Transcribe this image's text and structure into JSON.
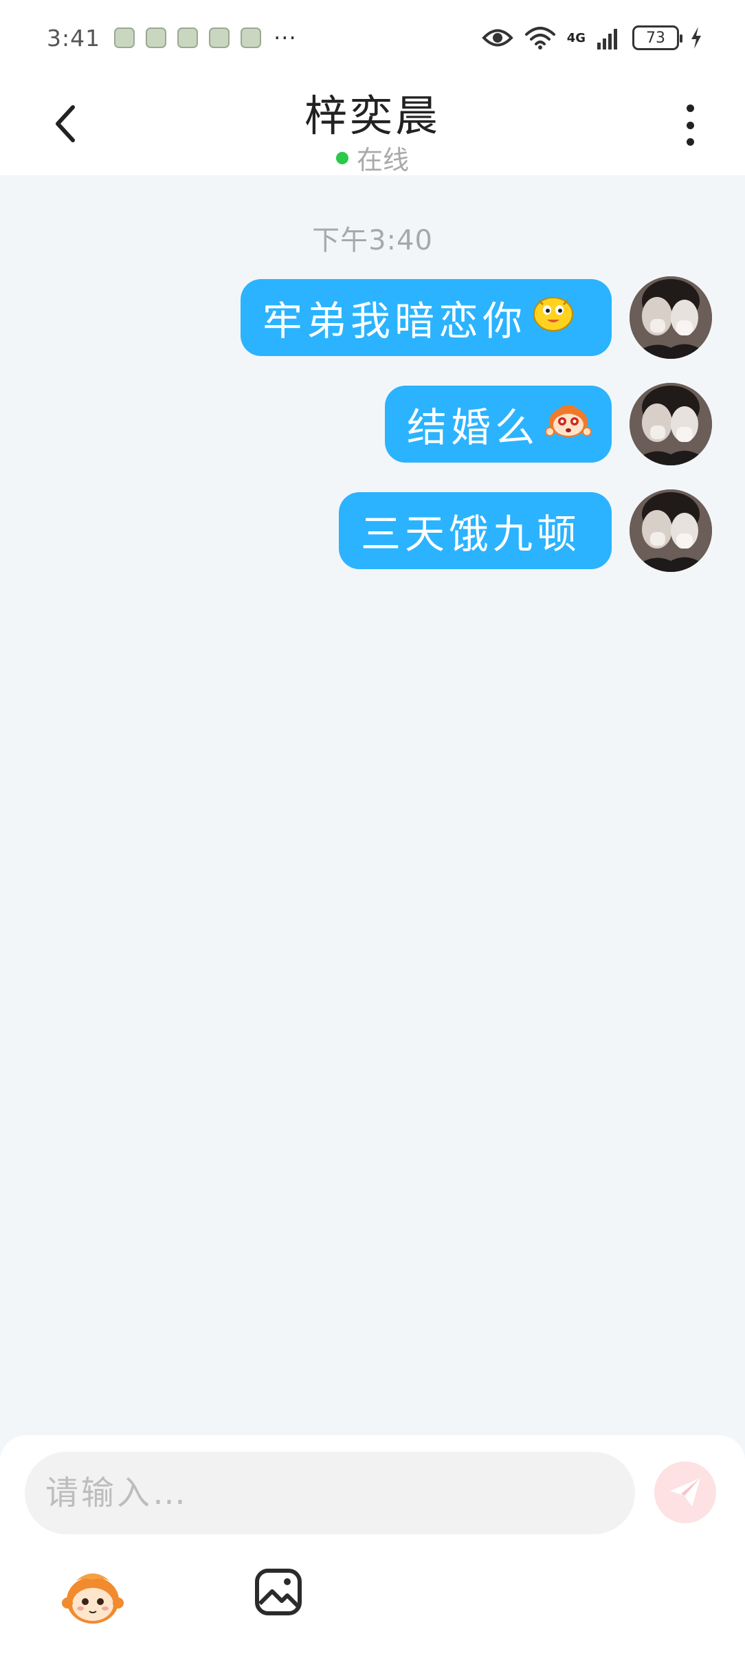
{
  "status_bar": {
    "time": "3:41",
    "app_icons": [
      "app-notification-icon",
      "app-notification-icon",
      "app-notification-icon",
      "app-notification-icon",
      "app-notification-icon"
    ],
    "more": "···",
    "network": "4G",
    "battery": "73"
  },
  "header": {
    "title": "梓奕晨",
    "status": "在线",
    "status_color": "#29c94a"
  },
  "chat": {
    "timestamp": "下午3:40",
    "bubble_color": "#2bb3ff",
    "messages": [
      {
        "text": "牢弟我暗恋你",
        "emoji": "yellow-blob-emoji"
      },
      {
        "text": "结婚么",
        "emoji": "orange-monkey-emoji"
      },
      {
        "text": "三天饿九顿",
        "emoji": ""
      }
    ]
  },
  "input": {
    "placeholder": "请输入…",
    "value": ""
  },
  "toolbar": {
    "emoji_icon": "monkey-sticker-icon",
    "image_icon": "image-icon",
    "send_icon": "send-plane-icon"
  }
}
